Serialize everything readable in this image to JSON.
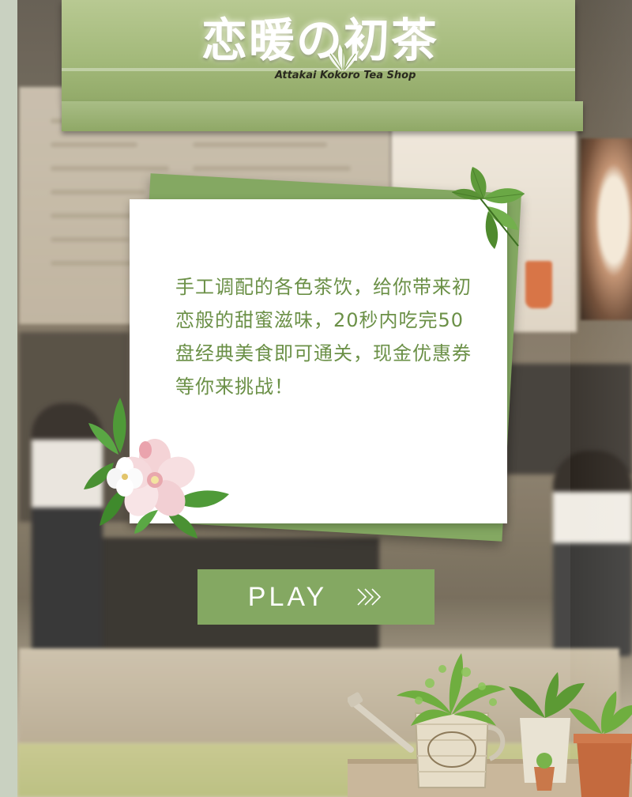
{
  "sign": {
    "title_cn": "恋暖の初茶",
    "subtitle_en": "Attakai Kokoro Tea Shop"
  },
  "intro": {
    "text": "手工调配的各色茶饮，给你带来初恋般的甜蜜滋味，20秒内吃完50盘经典美食即可通关，现金优惠券等你来挑战！"
  },
  "play_button": {
    "label": "PLAY",
    "icon": "triple-chevron-right-icon"
  },
  "colors": {
    "accent_green": "#84a862",
    "text_green": "#6b9047",
    "card_white": "#ffffff",
    "sign_green": "#a3b97a"
  }
}
